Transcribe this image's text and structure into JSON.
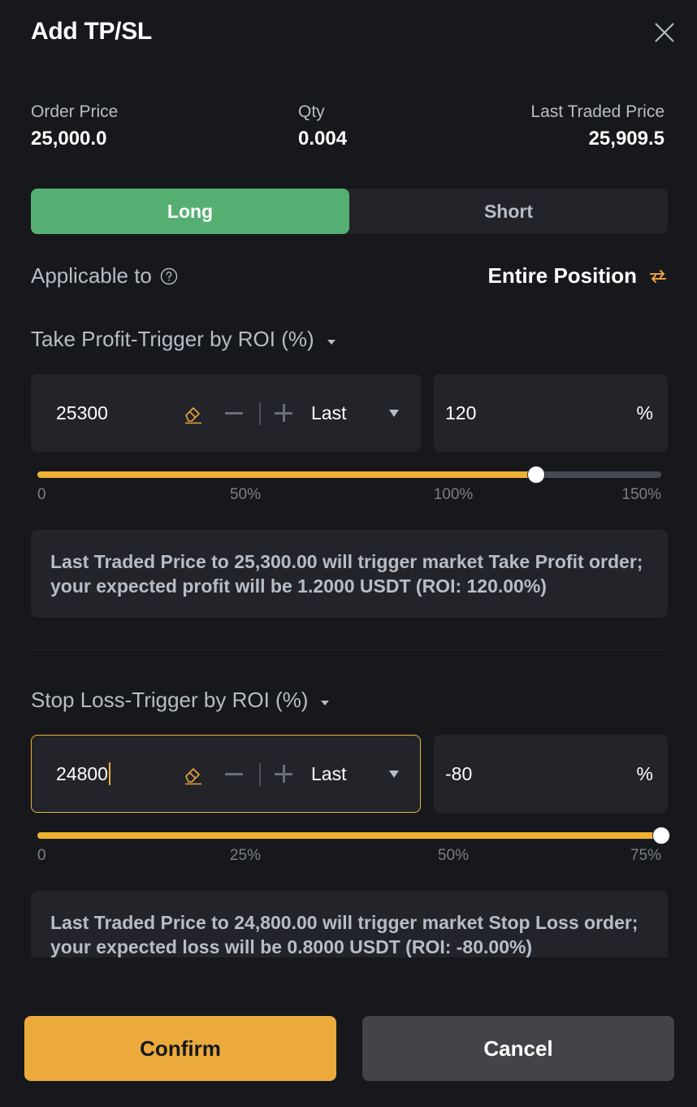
{
  "dialog": {
    "title": "Add TP/SL",
    "close_icon": "close-icon"
  },
  "summary": {
    "order_price_label": "Order Price",
    "order_price_value": "25,000.0",
    "qty_label": "Qty",
    "qty_value": "0.004",
    "last_price_label": "Last Traded Price",
    "last_price_value": "25,909.5"
  },
  "side_toggle": {
    "options": [
      {
        "label": "Long",
        "active": true
      },
      {
        "label": "Short",
        "active": false
      }
    ]
  },
  "applicable": {
    "label": "Applicable to",
    "help_icon": "help-circle-icon",
    "value": "Entire Position",
    "switch_icon": "swap-arrows-icon"
  },
  "take_profit": {
    "title": "Take Profit-Trigger by ROI (%)",
    "price_value": "25300",
    "trigger_type": "Last",
    "roi_value": "120",
    "roi_unit": "%",
    "slider": {
      "value_percent": 120,
      "max_percent": 150,
      "ticks": [
        "0",
        "50%",
        "100%",
        "150%"
      ]
    },
    "note": "Last Traded Price to 25,300.00 will trigger market Take Profit order; your expected profit will be 1.2000 USDT (ROI: 120.00%)"
  },
  "stop_loss": {
    "title": "Stop Loss-Trigger by ROI (%)",
    "price_value": "24800",
    "trigger_type": "Last",
    "roi_value": "-80",
    "roi_unit": "%",
    "slider": {
      "value_percent": 75,
      "max_percent": 75,
      "ticks": [
        "0",
        "25%",
        "50%",
        "75%"
      ]
    },
    "note": "Last Traded Price to 24,800.00 will trigger market Stop Loss order; your expected loss will be 0.8000 USDT (ROI: -80.00%)"
  },
  "actions": {
    "confirm_label": "Confirm",
    "cancel_label": "Cancel"
  },
  "colors": {
    "accent": "#f0b232",
    "long_green": "#55af72",
    "background": "#17181c",
    "panel": "#22242a"
  }
}
